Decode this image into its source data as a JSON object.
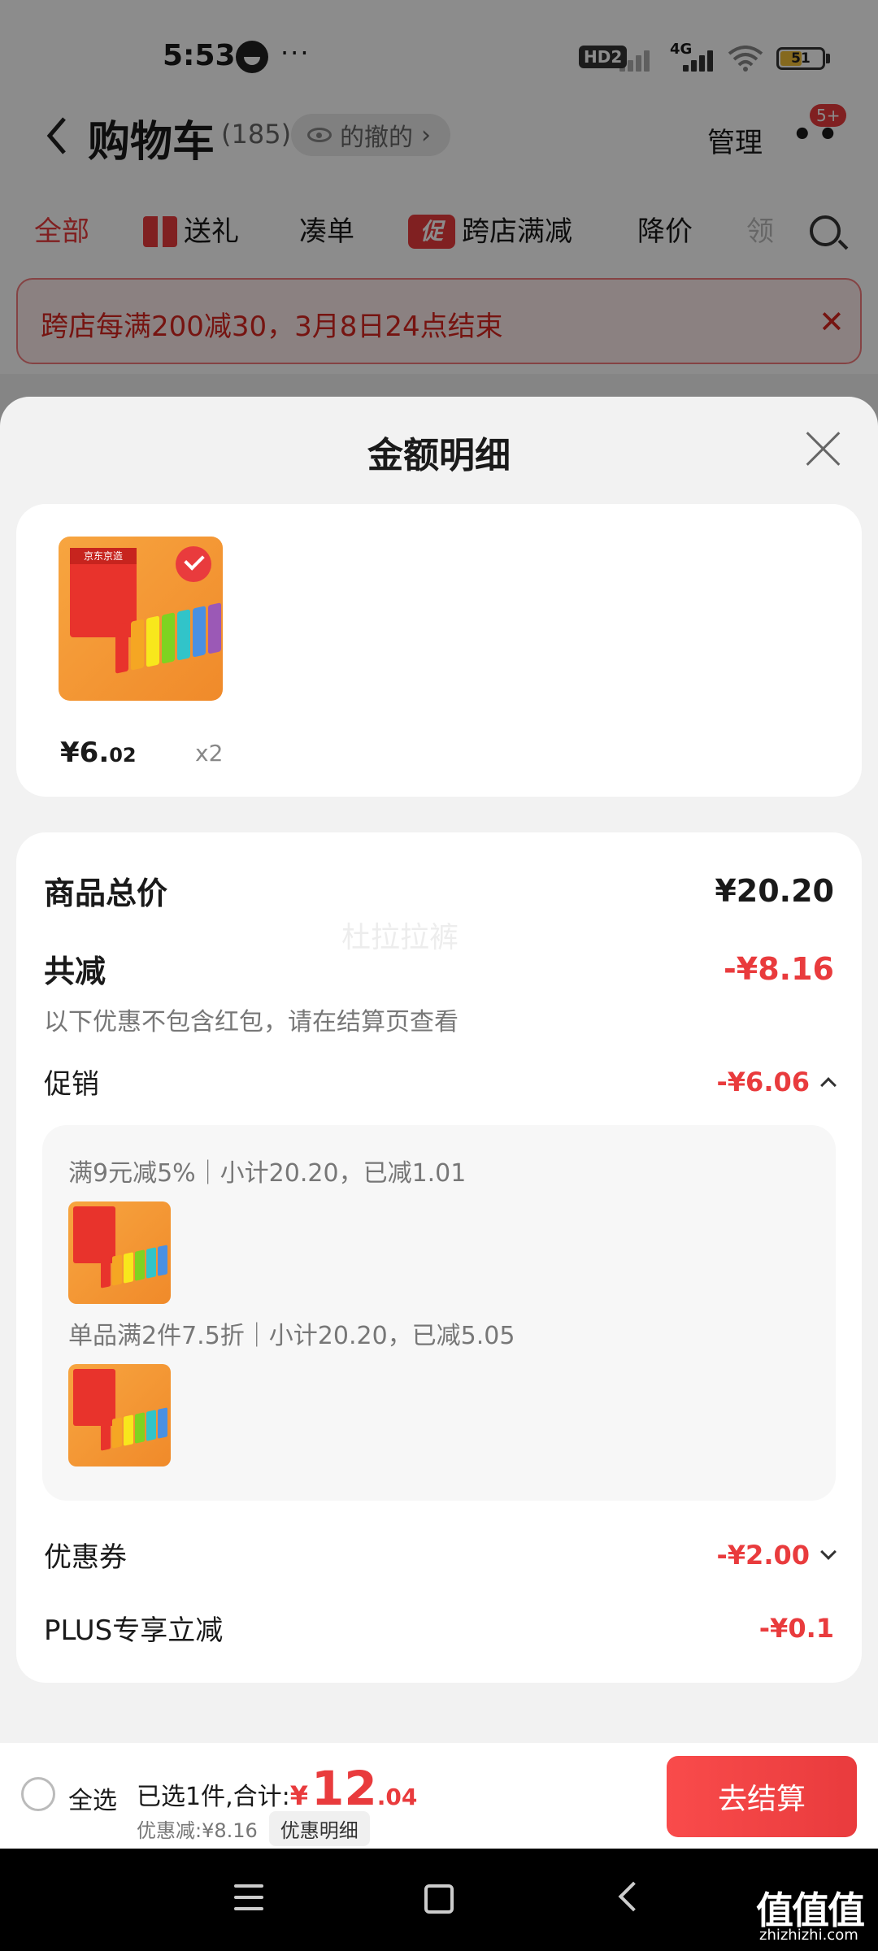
{
  "status": {
    "time": "5:53",
    "hd_label": "HD2",
    "network_label": "4G",
    "battery_level": "51",
    "battery_fraction": 0.51
  },
  "header": {
    "title": "购物车",
    "count": "(185)",
    "history_label": "的撤的",
    "manage_label": "管理",
    "more_badge": "5+"
  },
  "tabs": [
    {
      "label": "全部",
      "active": true
    },
    {
      "label": "送礼",
      "icon": "gift-icon"
    },
    {
      "label": "凑单"
    },
    {
      "label": "跨店满减",
      "badge": "促"
    },
    {
      "label": "降价"
    },
    {
      "label": "领"
    }
  ],
  "notice": {
    "text": "跨店每满200减30，3月8日24点结束",
    "close_glyph": "✕"
  },
  "sheet": {
    "title": "金额明细",
    "product": {
      "brand_label": "京东京造",
      "price_main": "¥6.",
      "price_cents": "02",
      "quantity": "x2"
    },
    "watermark": "杜拉拉裤",
    "total_label": "商品总价",
    "total_value": "¥20.20",
    "discount_label": "共减",
    "discount_value": "-¥8.16",
    "discount_note": "以下优惠不包含红包，请在结算页查看",
    "promo_label": "促销",
    "promo_value": "-¥6.06",
    "promo_lines": [
      "满9元减5%｜小计20.20，已减1.01",
      "单品满2件7.5折｜小计20.20，已减5.05"
    ],
    "coupon_label": "优惠券",
    "coupon_value": "-¥2.00",
    "plus_label": "PLUS专享立减",
    "plus_value": "-¥0.1"
  },
  "checkout": {
    "select_all": "全选",
    "selected_text": "已选1件,合计:",
    "currency": "¥",
    "total_main": "12",
    "total_cents": ".04",
    "discount_text": "优惠减:¥8.16",
    "detail_chip": "优惠明细",
    "checkout_button": "去结算"
  },
  "watermark_site": {
    "logo": "值值值",
    "url": "zhizhizhi.com"
  },
  "colors": {
    "accent": "#e93b3d",
    "battery": "#f3c038",
    "product_orange": "#f39a35"
  }
}
